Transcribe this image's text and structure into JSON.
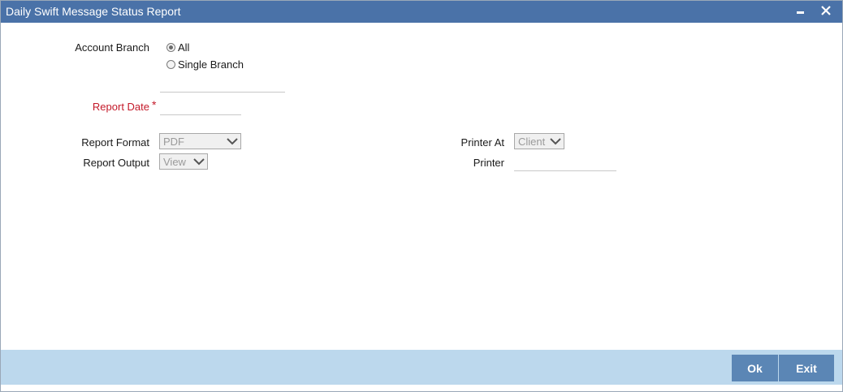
{
  "window": {
    "title": "Daily Swift Message Status Report",
    "minimize_icon": "minimize-icon",
    "close_icon": "close-icon"
  },
  "form": {
    "account_branch": {
      "label": "Account Branch",
      "options": [
        {
          "label": "All",
          "checked": true
        },
        {
          "label": "Single Branch",
          "checked": false
        }
      ],
      "branch_value": ""
    },
    "report_date": {
      "label": "Report Date",
      "required_marker": "*",
      "value": ""
    },
    "report_format": {
      "label": "Report Format",
      "value": "PDF"
    },
    "report_output": {
      "label": "Report Output",
      "value": "View"
    },
    "printer_at": {
      "label": "Printer At",
      "value": "Client"
    },
    "printer": {
      "label": "Printer",
      "value": ""
    }
  },
  "footer": {
    "ok_label": "Ok",
    "exit_label": "Exit"
  },
  "colors": {
    "titlebar": "#4a72a8",
    "footer": "#bcd8ed",
    "button": "#5b86b5",
    "required": "#c41a2a"
  }
}
